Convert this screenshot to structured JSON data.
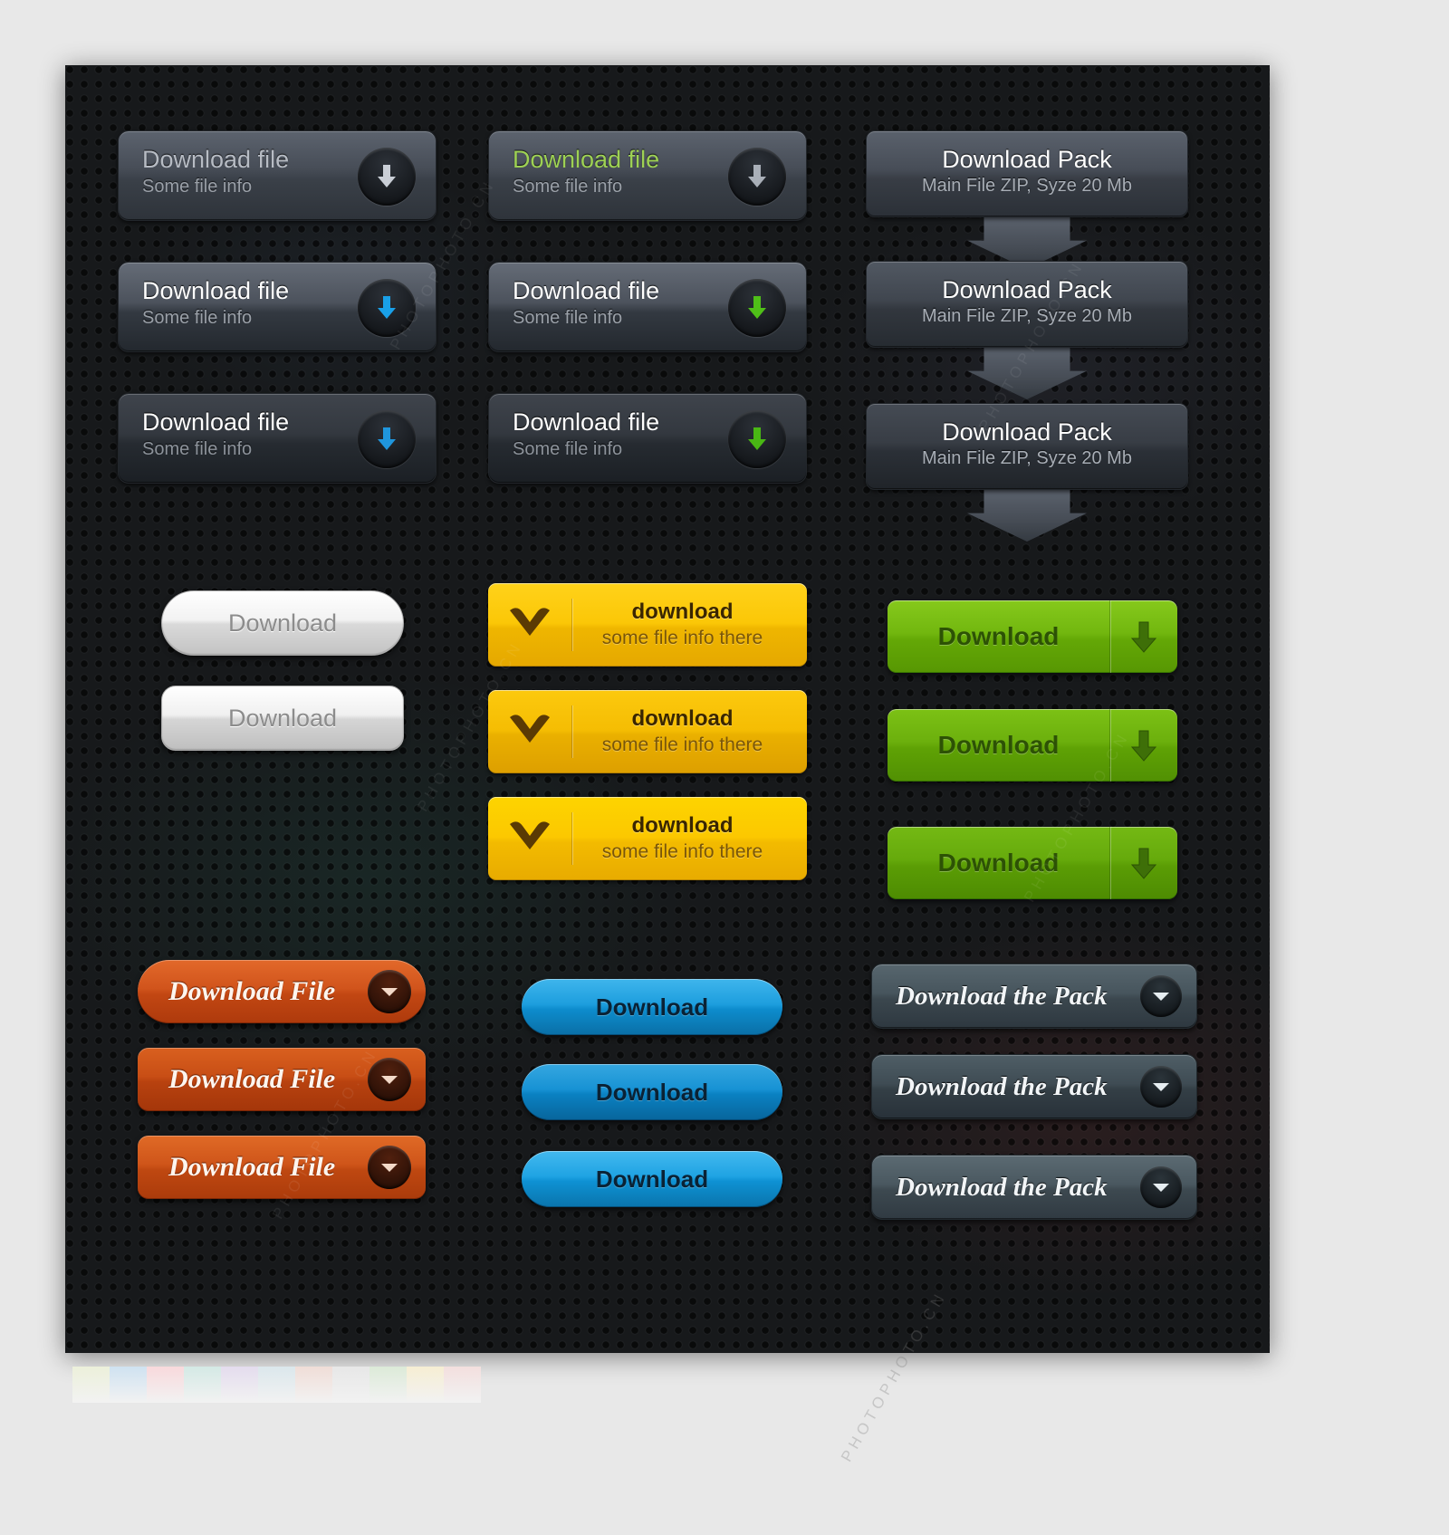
{
  "panel": {
    "background_color": "#17191b"
  },
  "groups": {
    "dark_file_buttons_col1": [
      {
        "title": "Download file",
        "subtitle": "Some file info",
        "arrow_icon": "download-arrow-icon",
        "arrow_color": "#c9ced6",
        "state": "default"
      },
      {
        "title": "Download file",
        "subtitle": "Some file info",
        "arrow_icon": "download-arrow-icon",
        "arrow_color": "#19a0e8",
        "state": "hover"
      },
      {
        "title": "Download file",
        "subtitle": "Some file info",
        "arrow_icon": "download-arrow-icon",
        "arrow_color": "#1f96dd",
        "state": "pressed"
      }
    ],
    "dark_file_buttons_col2": [
      {
        "title": "Download file",
        "subtitle": "Some file info",
        "arrow_icon": "download-arrow-icon",
        "arrow_color": "#a9afb8",
        "title_color": "#9ed154",
        "state": "default"
      },
      {
        "title": "Download file",
        "subtitle": "Some file info",
        "arrow_icon": "download-arrow-icon",
        "arrow_color": "#4fbf18",
        "state": "hover"
      },
      {
        "title": "Download file",
        "subtitle": "Some file info",
        "arrow_icon": "download-arrow-icon",
        "arrow_color": "#49b714",
        "state": "pressed"
      }
    ],
    "pack_buttons": [
      {
        "title": "Download Pack",
        "subtitle": "Main File ZIP, Syze 20 Mb",
        "tail_icon": "arrow-tail-down-icon"
      },
      {
        "title": "Download Pack",
        "subtitle": "Main File ZIP, Syze 20 Mb",
        "tail_icon": "arrow-tail-down-icon"
      },
      {
        "title": "Download Pack",
        "subtitle": "Main File ZIP, Syze 20 Mb",
        "tail_icon": "arrow-tail-down-icon"
      }
    ],
    "silver_pills": [
      {
        "label": "Download",
        "shape": "pill"
      },
      {
        "label": "Download",
        "shape": "rounded-rect"
      }
    ],
    "yellow_buttons": [
      {
        "icon": "heart-chevron-down-icon",
        "title": "download",
        "subtitle": "some file info there",
        "accent": "#fbc707"
      },
      {
        "icon": "heart-chevron-down-icon",
        "title": "download",
        "subtitle": "some file info there",
        "accent": "#f5bd03"
      },
      {
        "icon": "heart-chevron-down-icon",
        "title": "download",
        "subtitle": "some file info there",
        "accent": "#fcc800"
      }
    ],
    "green_buttons": [
      {
        "label": "Download",
        "icon": "download-arrow-icon",
        "accent": "#72b70f"
      },
      {
        "label": "Download",
        "icon": "download-arrow-icon",
        "accent": "#6cb00d"
      },
      {
        "label": "Download",
        "icon": "download-arrow-icon",
        "accent": "#66aa0c"
      }
    ],
    "orange_buttons": [
      {
        "label": "Download File",
        "icon": "caret-down-circle-icon",
        "accent": "#d1541c"
      },
      {
        "label": "Download File",
        "icon": "caret-down-circle-icon",
        "accent": "#c84e15"
      },
      {
        "label": "Download File",
        "icon": "caret-down-circle-icon",
        "accent": "#cf551a"
      }
    ],
    "blue_buttons": [
      {
        "label": "Download",
        "accent": "#1d9ede"
      },
      {
        "label": "Download",
        "accent": "#1792d4"
      },
      {
        "label": "Download",
        "accent": "#1fa3e3"
      }
    ],
    "slate_pack_buttons": [
      {
        "label": "Download the Pack",
        "icon": "caret-down-circle-icon",
        "accent": "#47555d"
      },
      {
        "label": "Download the Pack",
        "icon": "caret-down-circle-icon",
        "accent": "#3f4c54"
      },
      {
        "label": "Download the Pack",
        "icon": "caret-down-circle-icon",
        "accent": "#4a5860"
      }
    ]
  },
  "swatches": {
    "colors": [
      "#7d9e10",
      "#0a7fc9",
      "#ef2b3e",
      "#0b8f83",
      "#9b59cc",
      "#5ca3b0",
      "#c0705f",
      "#8f8f8f",
      "#2f8a0d",
      "#efae06",
      "#8f1404"
    ],
    "pale_colors": [
      "#ecf0da",
      "#cfe2f1",
      "#f8d9dc",
      "#d4e9e5",
      "#e4dcee",
      "#dbe7ec",
      "#f0ddd7",
      "#e7e7e7",
      "#dcead8",
      "#f6eed3",
      "#f3dfde"
    ]
  },
  "watermark": {
    "text": "PHOTOPHOTO.CN"
  }
}
